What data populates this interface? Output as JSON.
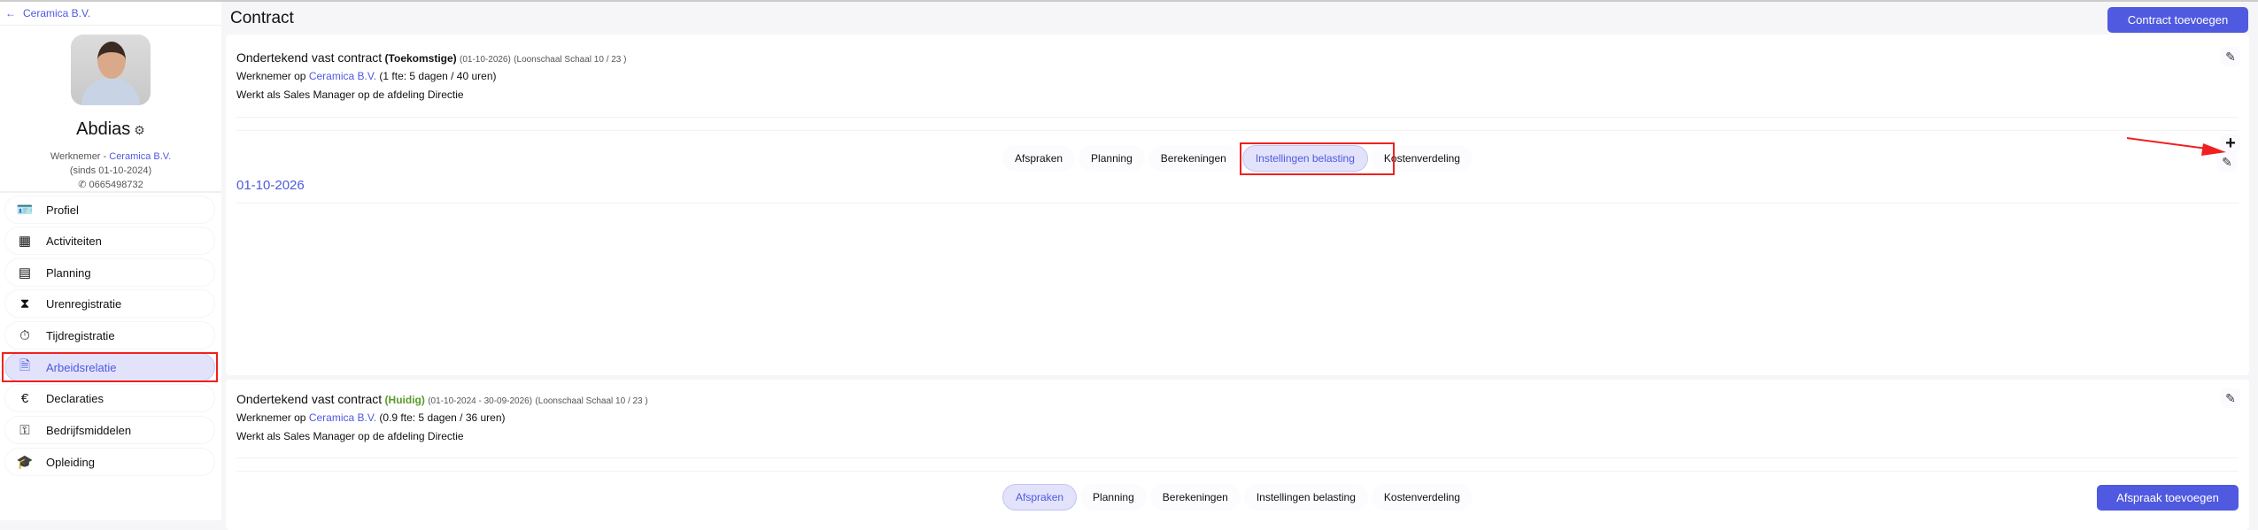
{
  "sidebar": {
    "back_label": "Ceramica B.V.",
    "name": "Abdias",
    "role": "Werknemer - ",
    "company": "Ceramica B.V.",
    "since": "(sinds 01-10-2024)",
    "phone": "0665498732",
    "items": [
      {
        "label": "Profiel",
        "icon": "id-card-icon"
      },
      {
        "label": "Activiteiten",
        "icon": "table-icon"
      },
      {
        "label": "Planning",
        "icon": "calendar-icon"
      },
      {
        "label": "Urenregistratie",
        "icon": "hourglass-icon"
      },
      {
        "label": "Tijdregistratie",
        "icon": "stopwatch-icon"
      },
      {
        "label": "Arbeidsrelatie",
        "icon": "document-icon"
      },
      {
        "label": "Declaraties",
        "icon": "euro-icon"
      },
      {
        "label": "Bedrijfsmiddelen",
        "icon": "key-icon"
      },
      {
        "label": "Opleiding",
        "icon": "graduation-cap-icon"
      }
    ]
  },
  "header": {
    "title": "Contract",
    "add_contract": "Contract toevoegen"
  },
  "contracts": [
    {
      "title": "Ondertekend vast contract",
      "status": "(Toekomstige)",
      "dates": "(01-10-2026)",
      "scale": "(Loonschaal Schaal 10 / 23 )",
      "employer_prefix": "Werknemer op ",
      "employer": "Ceramica B.V.",
      "fte": " (1 fte: 5 dagen / 40 uren)",
      "role": "Werkt als Sales Manager op de afdeling Directie",
      "tabs": [
        "Afspraken",
        "Planning",
        "Berekeningen",
        "Instellingen belasting",
        "Kostenverdeling"
      ],
      "active_tab": 3,
      "entry_date": "01-10-2026"
    },
    {
      "title": "Ondertekend vast contract",
      "status": "(Huidig)",
      "dates": "(01-10-2024 - 30-09-2026)",
      "scale": "(Loonschaal Schaal 10 / 23 )",
      "employer_prefix": "Werknemer op ",
      "employer": "Ceramica B.V.",
      "fte": " (0.9 fte: 5 dagen / 36 uren)",
      "role": "Werkt als Sales Manager op de afdeling Directie",
      "tabs": [
        "Afspraken",
        "Planning",
        "Berekeningen",
        "Instellingen belasting",
        "Kostenverdeling"
      ],
      "active_tab": 0,
      "add_label": "Afspraak toevoegen"
    }
  ]
}
